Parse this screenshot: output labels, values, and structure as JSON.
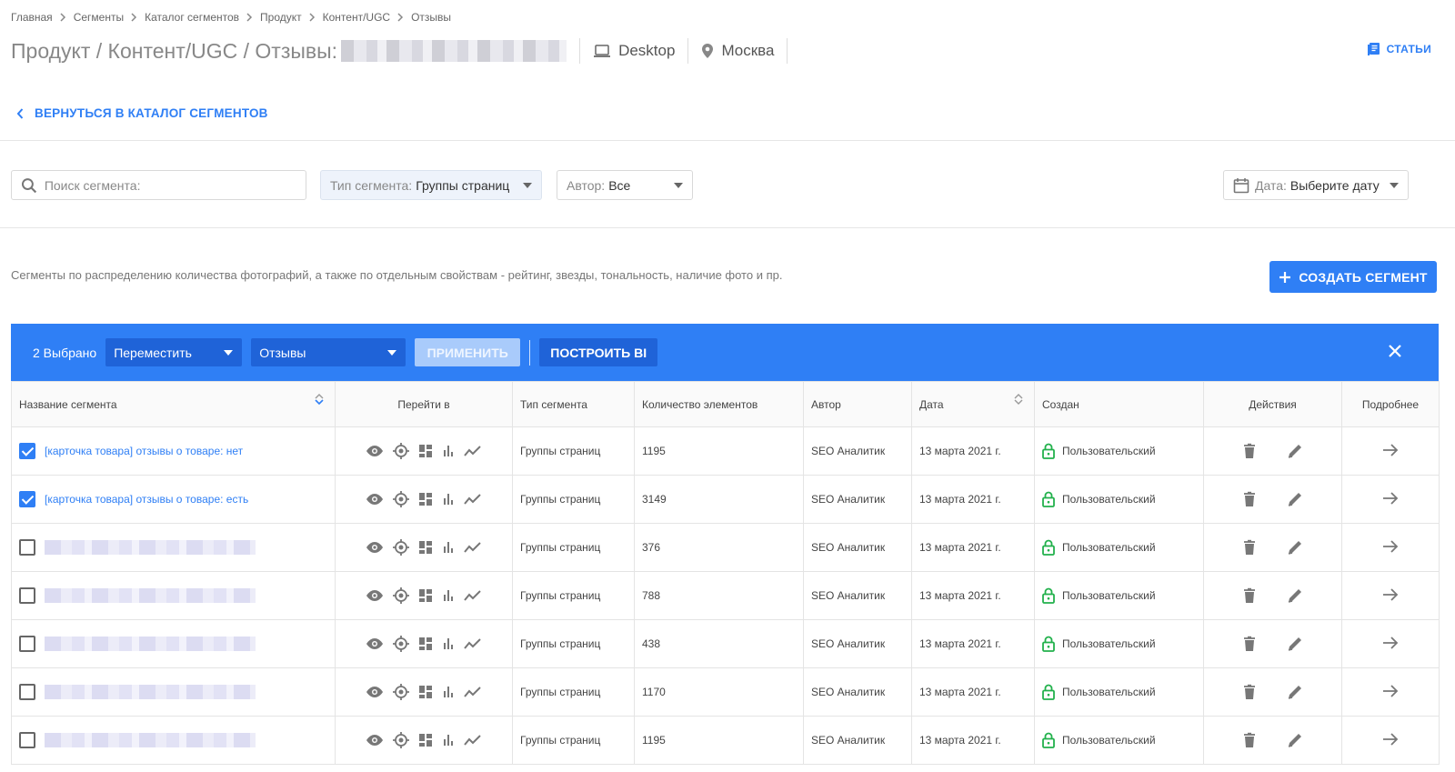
{
  "breadcrumb": [
    "Главная",
    "Сегменты",
    "Каталог сегментов",
    "Продукт",
    "Контент/UGC",
    "Отзывы"
  ],
  "header": {
    "title": "Продукт / Контент/UGC / Отзывы:",
    "device": "Desktop",
    "region": "Москва",
    "articles_label": "СТАТЬИ"
  },
  "back_label": "ВЕРНУТЬСЯ В КАТАЛОГ СЕГМЕНТОВ",
  "filters": {
    "search_placeholder": "Поиск сегмента:",
    "type_label": "Тип сегмента:",
    "type_value": "Группы страниц",
    "author_label": "Автор:",
    "author_value": "Все",
    "date_label": "Дата:",
    "date_value": "Выберите дату"
  },
  "description": "Сегменты по распределению количества фотографий, а также по отдельным свойствам - рейтинг, звезды, тональность, наличие фото и пр.",
  "create_label": "СОЗДАТЬ СЕГМЕНТ",
  "toolbar": {
    "count": "2 Выбрано",
    "action": "Переместить",
    "target": "Отзывы",
    "apply_label": "ПРИМЕНИТЬ",
    "bi_label": "ПОСТРОИТЬ BI"
  },
  "columns": [
    "Название сегмента",
    "Перейти в",
    "Тип сегмента",
    "Количество элементов",
    "Автор",
    "Дата",
    "Создан",
    "Действия",
    "Подробнее"
  ],
  "rows": [
    {
      "name": "[карточка товара] отзывы о товаре: нет",
      "checked": true,
      "type": "Группы страниц",
      "count": "1195",
      "author": "SEO Аналитик",
      "date": "13 марта 2021 г.",
      "created": "Пользовательский"
    },
    {
      "name": "[карточка товара] отзывы о товаре: есть",
      "checked": true,
      "type": "Группы страниц",
      "count": "3149",
      "author": "SEO Аналитик",
      "date": "13 марта 2021 г.",
      "created": "Пользовательский"
    },
    {
      "name": "",
      "checked": false,
      "type": "Группы страниц",
      "count": "376",
      "author": "SEO Аналитик",
      "date": "13 марта 2021 г.",
      "created": "Пользовательский"
    },
    {
      "name": "",
      "checked": false,
      "type": "Группы страниц",
      "count": "788",
      "author": "SEO Аналитик",
      "date": "13 марта 2021 г.",
      "created": "Пользовательский"
    },
    {
      "name": "",
      "checked": false,
      "type": "Группы страниц",
      "count": "438",
      "author": "SEO Аналитик",
      "date": "13 марта 2021 г.",
      "created": "Пользовательский"
    },
    {
      "name": "",
      "checked": false,
      "type": "Группы страниц",
      "count": "1170",
      "author": "SEO Аналитик",
      "date": "13 марта 2021 г.",
      "created": "Пользовательский"
    },
    {
      "name": "",
      "checked": false,
      "type": "Группы страниц",
      "count": "1195",
      "author": "SEO Аналитик",
      "date": "13 марта 2021 г.",
      "created": "Пользовательский"
    }
  ],
  "colors": {
    "accent": "#2f7ff5",
    "accent_dark": "#1f63d8",
    "lock": "#22b14c"
  }
}
